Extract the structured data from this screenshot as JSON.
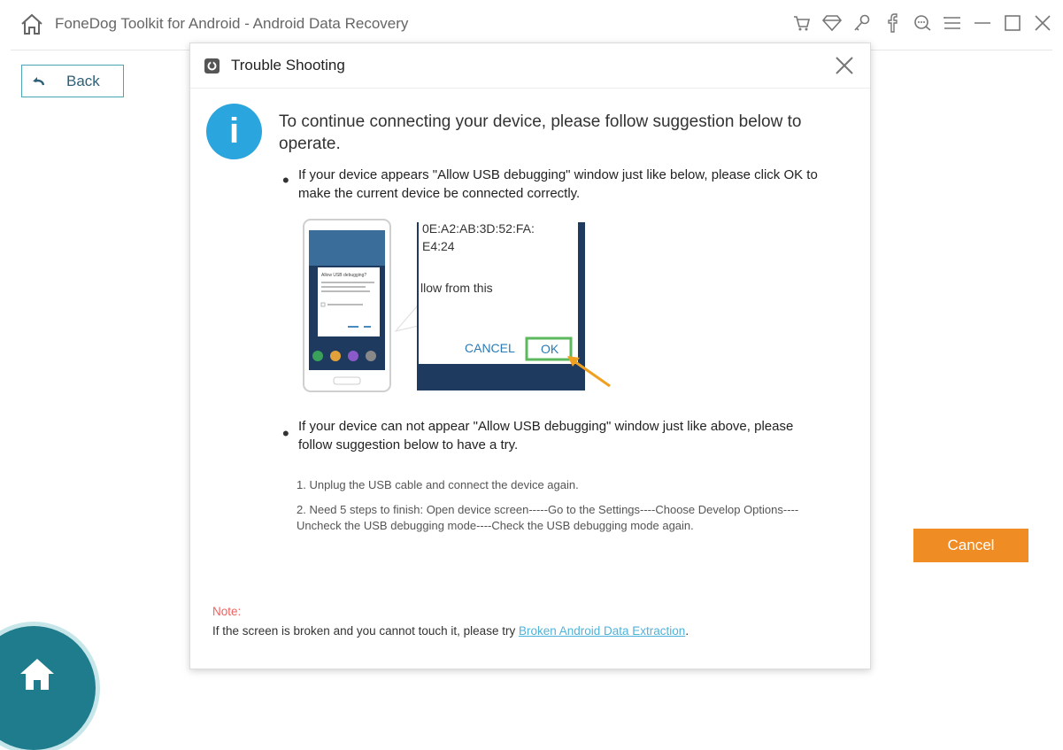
{
  "window": {
    "title": "FoneDog Toolkit for Android - Android Data Recovery",
    "toolbar_icons": [
      "cart-icon",
      "diamond-icon",
      "key-icon",
      "facebook-icon",
      "chat-icon",
      "menu-icon",
      "minimize-icon",
      "maximize-icon",
      "close-icon"
    ]
  },
  "back_button": {
    "label": "Back"
  },
  "cancel_button": {
    "label": "Cancel"
  },
  "dialog": {
    "title": "Trouble Shooting",
    "lead": "To continue connecting your device, please follow suggestion below to operate.",
    "bullet1": "If your device appears \"Allow USB debugging\" window just like below, please click OK to make the current device  be connected correctly.",
    "bullet2": "If your device can not appear \"Allow USB debugging\" window just like above, please follow suggestion below to have a try.",
    "illustration": {
      "line1": "0E:A2:AB:3D:52:FA:",
      "line2": "E4:24",
      "line3": "llow from this",
      "cancel": "CANCEL",
      "ok": "OK",
      "phone_dialog_title": "Allow USB debugging?"
    },
    "steps": [
      "1. Unplug the USB cable and connect the device again.",
      "2. Need 5 steps to finish: Open device screen-----Go to the Settings----Choose Develop Options----Uncheck the USB debugging mode----Check the USB debugging mode again."
    ],
    "note_label": "Note:",
    "note_text": "If the screen is broken and you cannot touch it, please try ",
    "note_link": "Broken Android Data Extraction",
    "note_end": "."
  },
  "colors": {
    "accent_teal": "#1e7c8c",
    "cancel_orange": "#f08c24",
    "info_blue": "#2ba5dd",
    "note_red": "#f06262",
    "link_blue": "#4fb3d9",
    "ok_green": "#5cb85c"
  }
}
